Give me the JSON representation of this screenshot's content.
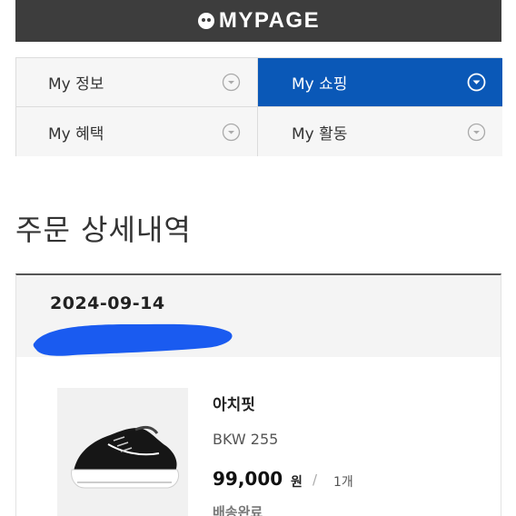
{
  "header": {
    "title": "MYPAGE",
    "logo_icon": "face-logo-icon"
  },
  "menu": {
    "items": [
      {
        "label": "My 정보",
        "active": false
      },
      {
        "label": "My 쇼핑",
        "active": true
      },
      {
        "label": "My 혜택",
        "active": false
      },
      {
        "label": "My 활동",
        "active": false
      }
    ]
  },
  "page": {
    "title": "주문 상세내역"
  },
  "order": {
    "date": "2024-09-14",
    "product": {
      "name": "아치핏",
      "option": "BKW 255",
      "price": "99,000",
      "currency": "원",
      "separator": "/",
      "quantity": "1개",
      "status": "배송완료",
      "image_icon": "sneaker-image"
    }
  },
  "colors": {
    "header_bg": "#3d3d3d",
    "accent": "#0a58b7",
    "scribble": "#1a5bf0"
  }
}
